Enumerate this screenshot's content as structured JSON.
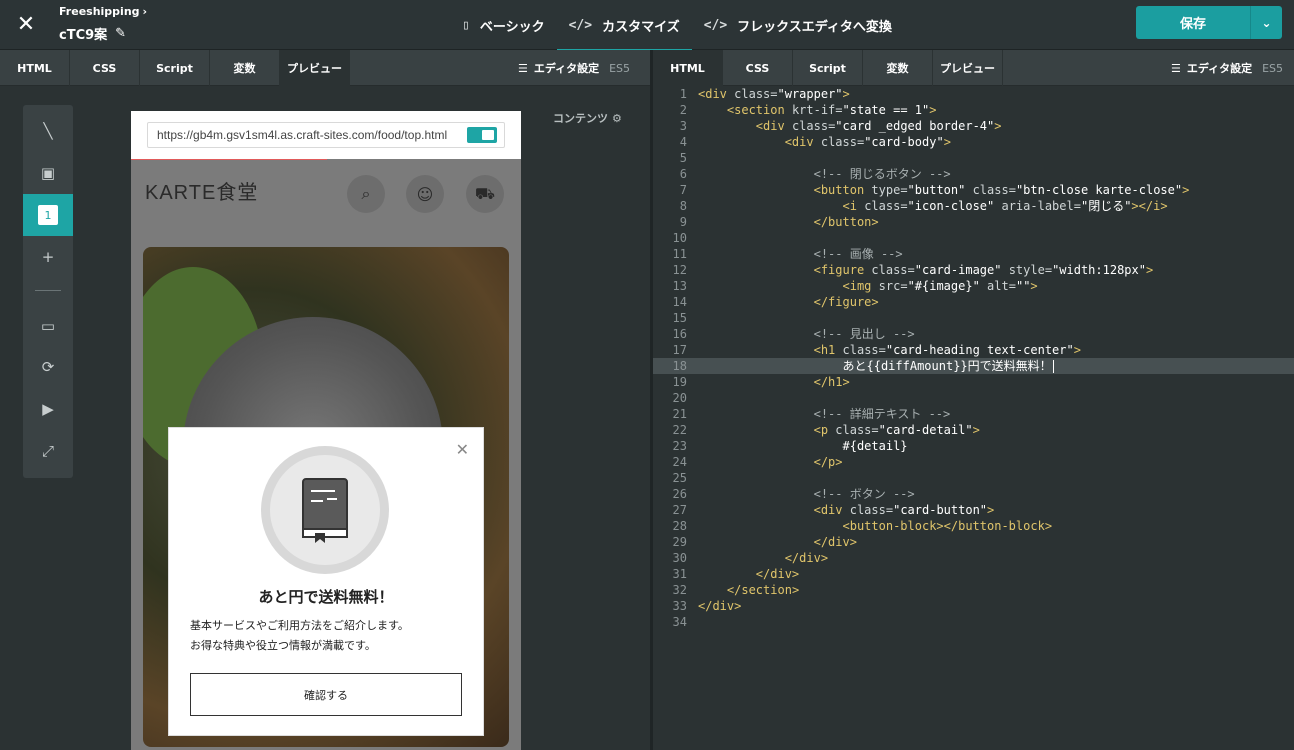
{
  "topbar": {
    "breadcrumb": "Freeshipping",
    "draft_name": "cTC9案",
    "modes": [
      {
        "icon": "▯",
        "label": "ベーシック"
      },
      {
        "icon": "</>",
        "label": "カスタマイズ"
      },
      {
        "icon": "</>",
        "label": "フレックスエディタへ変換"
      }
    ],
    "save_label": "保存"
  },
  "left_panel": {
    "tabs": [
      "HTML",
      "CSS",
      "Script",
      "変数",
      "プレビュー"
    ],
    "active_tab": "プレビュー",
    "editor_settings": "エディタ設定",
    "es_version": "ES5",
    "palette": {
      "active_number": "1"
    },
    "contents_label": "コンテンツ"
  },
  "preview": {
    "url": "https://gb4m.gsv1sm4l.as.craft-sites.com/food/top.html",
    "site_logo": "KARTE食堂",
    "modal": {
      "heading": "あと円で送料無料！",
      "detail_line1": "基本サービスやご利用方法をご紹介します。",
      "detail_line2": "お得な特典や役立つ情報が満載です。",
      "button": "確認する"
    }
  },
  "right_panel": {
    "tabs": [
      "HTML",
      "CSS",
      "Script",
      "変数",
      "プレビュー"
    ],
    "active_tab": "HTML",
    "editor_settings": "エディタ設定",
    "es_version": "ES5",
    "current_line": 18
  },
  "code_lines": [
    "<div class=\"wrapper\">",
    "    <section krt-if=\"state == 1\">",
    "        <div class=\"card _edged border-4\">",
    "            <div class=\"card-body\">",
    "",
    "                <!-- 閉じるボタン -->",
    "                <button type=\"button\" class=\"btn-close karte-close\">",
    "                    <i class=\"icon-close\" aria-label=\"閉じる\"></i>",
    "                </button>",
    "",
    "                <!-- 画像 -->",
    "                <figure class=\"card-image\" style=\"width:128px\">",
    "                    <img src=\"#{image}\" alt=\"\">",
    "                </figure>",
    "",
    "                <!-- 見出し -->",
    "                <h1 class=\"card-heading text-center\">",
    "                    あと{{diffAmount}}円で送料無料！",
    "                </h1>",
    "",
    "                <!-- 詳細テキスト -->",
    "                <p class=\"card-detail\">",
    "                    #{detail}",
    "                </p>",
    "",
    "                <!-- ボタン -->",
    "                <div class=\"card-button\">",
    "                    <button-block></button-block>",
    "                </div>",
    "            </div>",
    "        </div>",
    "    </section>",
    "</div>",
    ""
  ]
}
